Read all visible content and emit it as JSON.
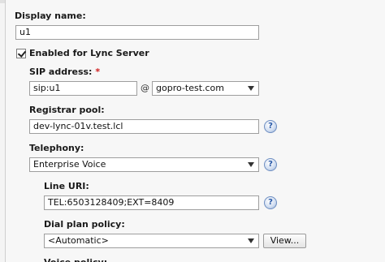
{
  "form": {
    "display_name": {
      "label": "Display name:",
      "value": "u1"
    },
    "enabled_lync": {
      "label": "Enabled for Lync Server",
      "checked": true
    },
    "sip_address": {
      "label": "SIP address:",
      "required_mark": "*",
      "value": "sip:u1",
      "at_sign": "@",
      "domain": "gopro-test.com"
    },
    "registrar_pool": {
      "label": "Registrar pool:",
      "value": "dev-lync-01v.test.lcl"
    },
    "telephony": {
      "label": "Telephony:",
      "value": "Enterprise Voice"
    },
    "line_uri": {
      "label": "Line URI:",
      "value": "TEL:6503128409;EXT=8409"
    },
    "dial_plan_policy": {
      "label": "Dial plan policy:",
      "value": "<Automatic>",
      "view_button": "View..."
    },
    "next_label_partial": "Voice policy:"
  },
  "help_glyph": "?",
  "icons": {
    "help": "help-question-icon",
    "dropdown": "chevron-down-icon",
    "check": "checkmark-icon"
  }
}
